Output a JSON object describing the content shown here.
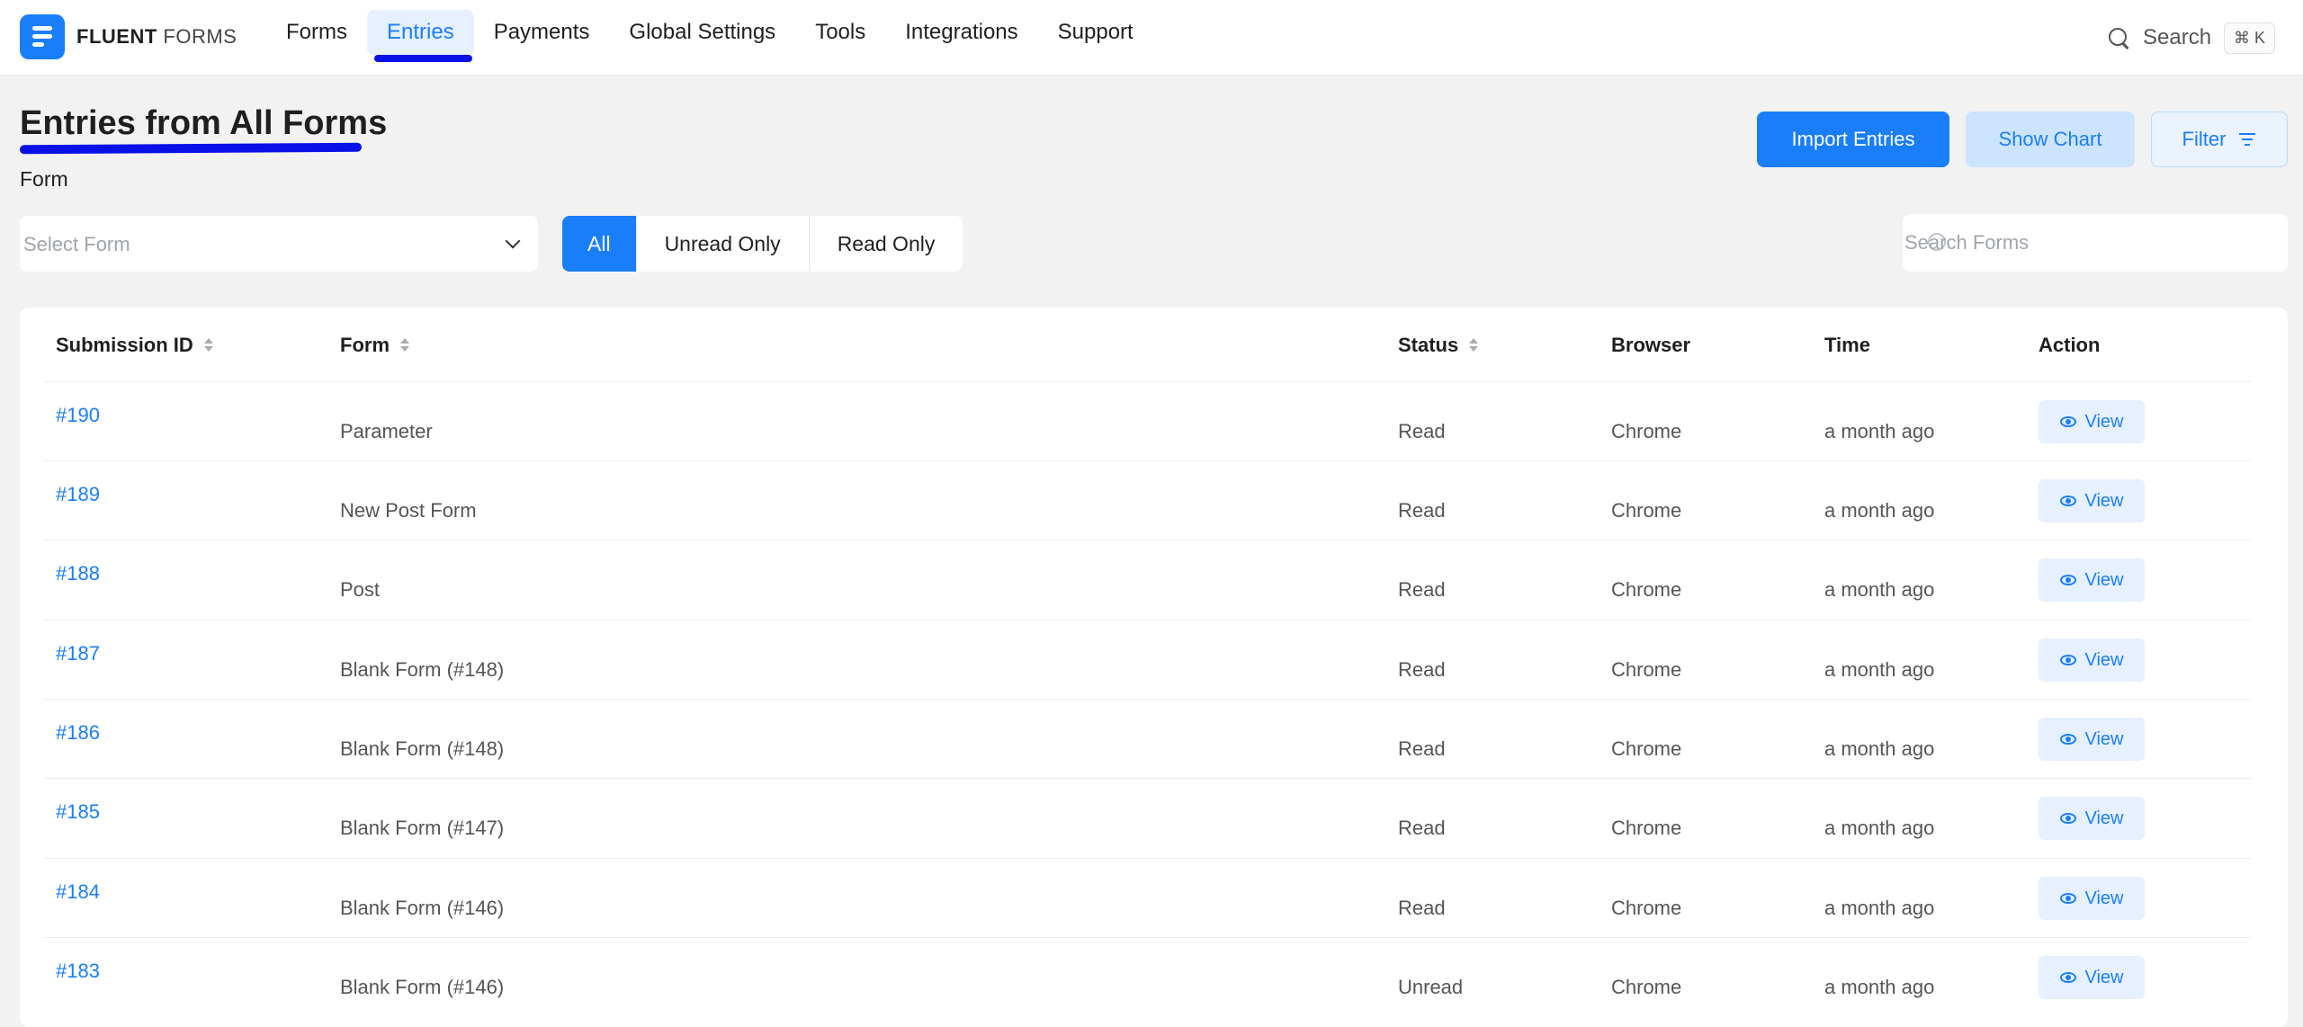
{
  "brand": {
    "bold": "FLUENT",
    "light": "FORMS"
  },
  "nav": {
    "items": [
      {
        "label": "Forms"
      },
      {
        "label": "Entries",
        "active": true
      },
      {
        "label": "Payments"
      },
      {
        "label": "Global Settings"
      },
      {
        "label": "Tools"
      },
      {
        "label": "Integrations"
      },
      {
        "label": "Support"
      }
    ],
    "search_label": "Search",
    "search_shortcut": "⌘ K"
  },
  "page": {
    "title": "Entries from All Forms",
    "import_label": "Import Entries",
    "chart_label": "Show Chart",
    "filter_label": "Filter",
    "form_label": "Form",
    "select_placeholder": "Select Form",
    "search_placeholder": "Search Forms"
  },
  "segments": [
    {
      "label": "All",
      "active": true
    },
    {
      "label": "Unread Only"
    },
    {
      "label": "Read Only"
    }
  ],
  "table": {
    "headers": [
      "Submission ID",
      "Form",
      "Status",
      "Browser",
      "Time",
      "Action"
    ],
    "rows": [
      {
        "id": "#190",
        "form": "Parameter",
        "status": "Read",
        "browser": "Chrome",
        "time": "a month ago",
        "action": "View"
      },
      {
        "id": "#189",
        "form": "New Post Form",
        "status": "Read",
        "browser": "Chrome",
        "time": "a month ago",
        "action": "View"
      },
      {
        "id": "#188",
        "form": "Post",
        "status": "Read",
        "browser": "Chrome",
        "time": "a month ago",
        "action": "View"
      },
      {
        "id": "#187",
        "form": "Blank Form (#148)",
        "status": "Read",
        "browser": "Chrome",
        "time": "a month ago",
        "action": "View"
      },
      {
        "id": "#186",
        "form": "Blank Form (#148)",
        "status": "Read",
        "browser": "Chrome",
        "time": "a month ago",
        "action": "View"
      },
      {
        "id": "#185",
        "form": "Blank Form (#147)",
        "status": "Read",
        "browser": "Chrome",
        "time": "a month ago",
        "action": "View"
      },
      {
        "id": "#184",
        "form": "Blank Form (#146)",
        "status": "Read",
        "browser": "Chrome",
        "time": "a month ago",
        "action": "View"
      },
      {
        "id": "#183",
        "form": "Blank Form (#146)",
        "status": "Unread",
        "browser": "Chrome",
        "time": "a month ago",
        "action": "View"
      }
    ]
  },
  "colors": {
    "accent": "#1a7efb",
    "annotation": "#0a10e8"
  }
}
